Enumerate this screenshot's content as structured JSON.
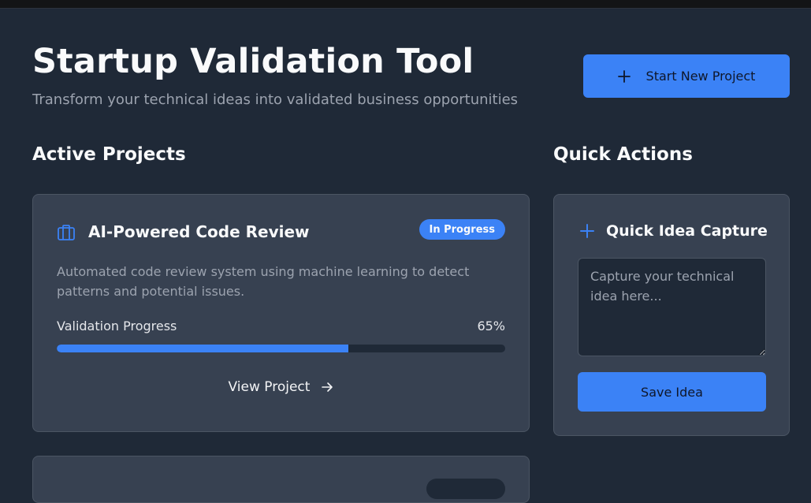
{
  "header": {
    "title": "Startup Validation Tool",
    "subtitle": "Transform your technical ideas into validated business opportunities",
    "new_project_label": "Start New Project"
  },
  "sections": {
    "active_projects": "Active Projects",
    "quick_actions": "Quick Actions"
  },
  "projects": [
    {
      "title": "AI-Powered Code Review",
      "status": "In Progress",
      "description": "Automated code review system using machine learning to detect patterns and potential issues.",
      "progress_label": "Validation Progress",
      "progress_text": "65%",
      "progress_value": 0.65,
      "view_label": "View Project"
    }
  ],
  "quick_idea": {
    "title": "Quick Idea Capture",
    "placeholder": "Capture your technical idea here...",
    "value": "",
    "save_label": "Save Idea"
  },
  "colors": {
    "background": "#1f2937",
    "card": "#374151",
    "accent": "#3b82f6",
    "muted_text": "#9ca3af"
  },
  "icons": {
    "new_project": "plus-icon",
    "project": "briefcase-icon",
    "view": "arrow-right-icon",
    "quick_idea": "plus-icon"
  }
}
